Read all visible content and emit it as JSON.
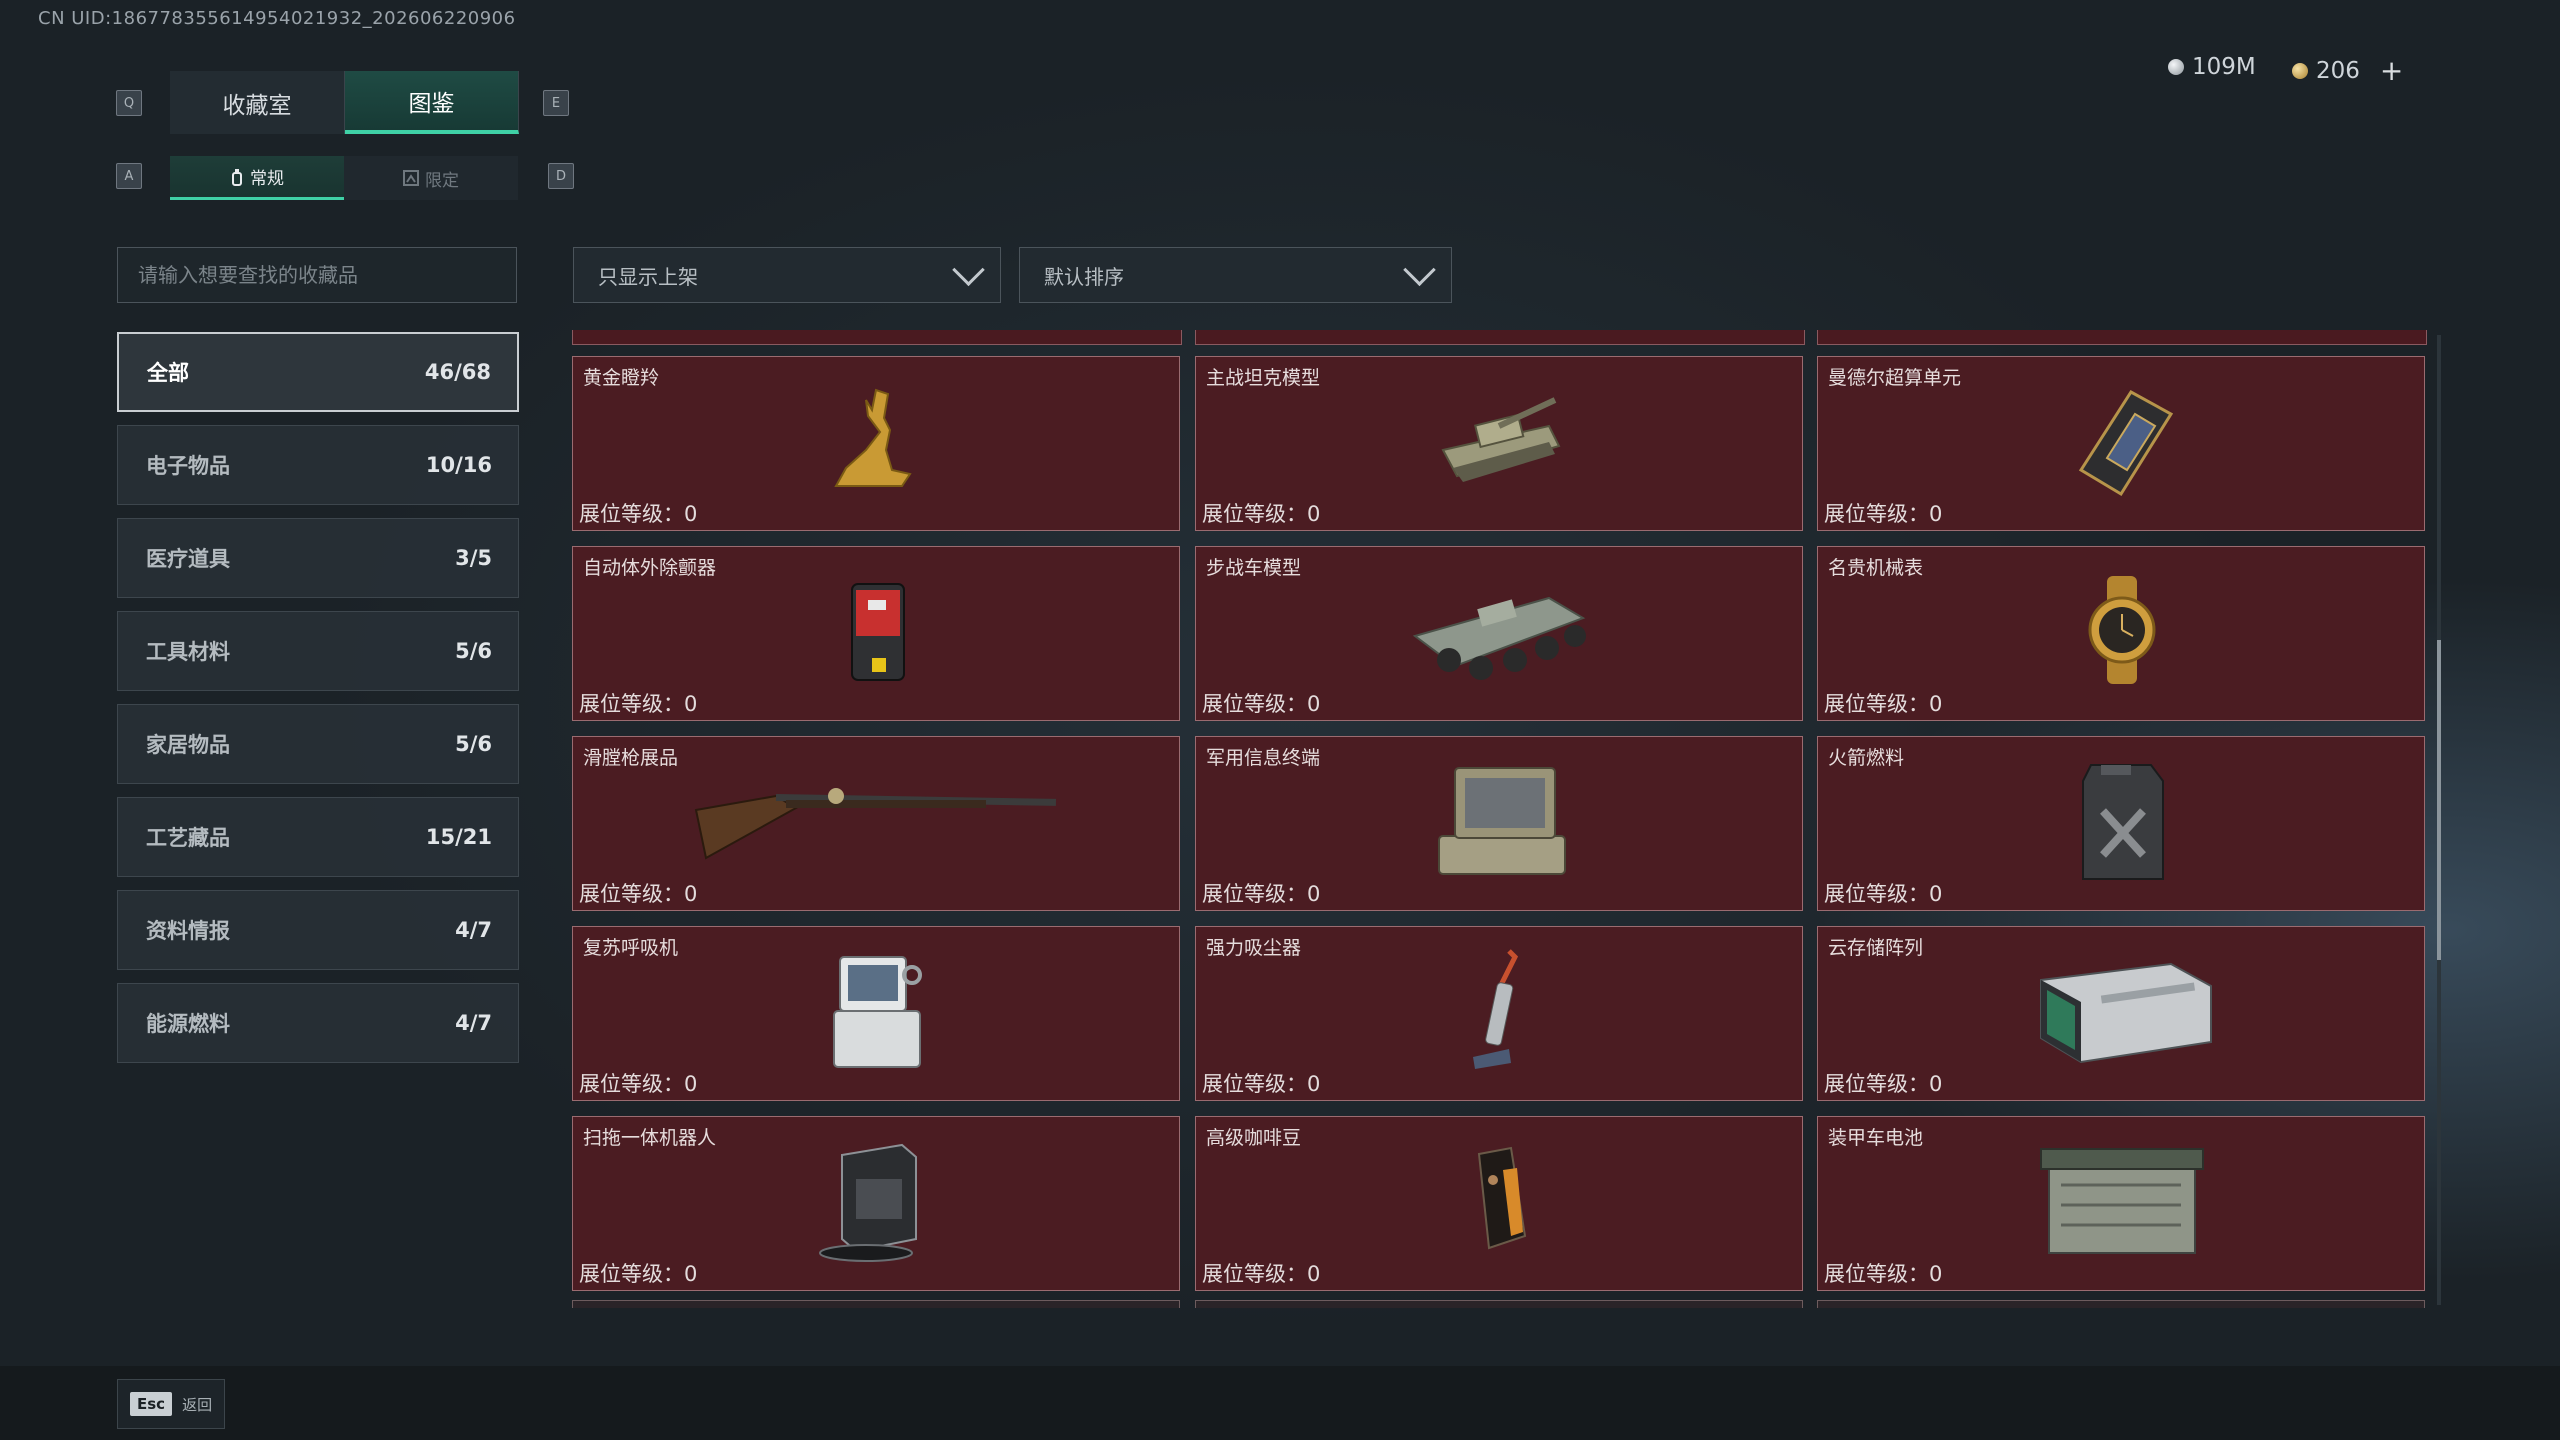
{
  "uid": "CN UID:18677835561495402193​2_202606220906",
  "currency": {
    "silver": "109M",
    "gold": "206",
    "plus": "+"
  },
  "key_hints": {
    "prev_tab": "Q",
    "next_tab": "E",
    "prev_sub": "A",
    "next_sub": "D"
  },
  "tabs": [
    {
      "label": "收藏室",
      "active": false
    },
    {
      "label": "图鉴",
      "active": true
    }
  ],
  "subtabs": [
    {
      "label": "常规",
      "active": true
    },
    {
      "label": "限定",
      "active": false
    }
  ],
  "search": {
    "placeholder": "请输入想要查找的收藏品",
    "value": ""
  },
  "filters": {
    "shelf": "只显示上架",
    "sort": "默认排序"
  },
  "categories": [
    {
      "label": "全部",
      "count": "46/68",
      "active": true
    },
    {
      "label": "电子物品",
      "count": "10/16"
    },
    {
      "label": "医疗道具",
      "count": "3/5"
    },
    {
      "label": "工具材料",
      "count": "5/6"
    },
    {
      "label": "家居物品",
      "count": "5/6"
    },
    {
      "label": "工艺藏品",
      "count": "15/21"
    },
    {
      "label": "资料情报",
      "count": "4/7"
    },
    {
      "label": "能源燃料",
      "count": "4/7"
    }
  ],
  "level_label": "展位等级：",
  "items": [
    {
      "name": "黄金瞪羚",
      "level": "0",
      "icon": "gold-gazelle-icon"
    },
    {
      "name": "主战坦克模型",
      "level": "0",
      "icon": "tank-model-icon"
    },
    {
      "name": "曼德尔超算单元",
      "level": "0",
      "icon": "supercomputer-unit-icon"
    },
    {
      "name": "自动体外除颤器",
      "level": "0",
      "icon": "defibrillator-icon"
    },
    {
      "name": "步战车模型",
      "level": "0",
      "icon": "ifv-model-icon"
    },
    {
      "name": "名贵机械表",
      "level": "0",
      "icon": "luxury-watch-icon"
    },
    {
      "name": "滑膛枪展品",
      "level": "0",
      "icon": "musket-icon"
    },
    {
      "name": "军用信息终端",
      "level": "0",
      "icon": "military-terminal-icon"
    },
    {
      "name": "火箭燃料",
      "level": "0",
      "icon": "rocket-fuel-icon"
    },
    {
      "name": "复苏呼吸机",
      "level": "0",
      "icon": "ventilator-icon"
    },
    {
      "name": "强力吸尘器",
      "level": "0",
      "icon": "vacuum-cleaner-icon"
    },
    {
      "name": "云存储阵列",
      "level": "0",
      "icon": "cloud-storage-icon"
    },
    {
      "name": "扫拖一体机器人",
      "level": "0",
      "icon": "robot-mop-icon"
    },
    {
      "name": "高级咖啡豆",
      "level": "0",
      "icon": "coffee-beans-icon"
    },
    {
      "name": "装甲车电池",
      "level": "0",
      "icon": "armored-battery-icon"
    }
  ],
  "footer": {
    "esc_key": "Esc",
    "esc_label": "返回"
  }
}
